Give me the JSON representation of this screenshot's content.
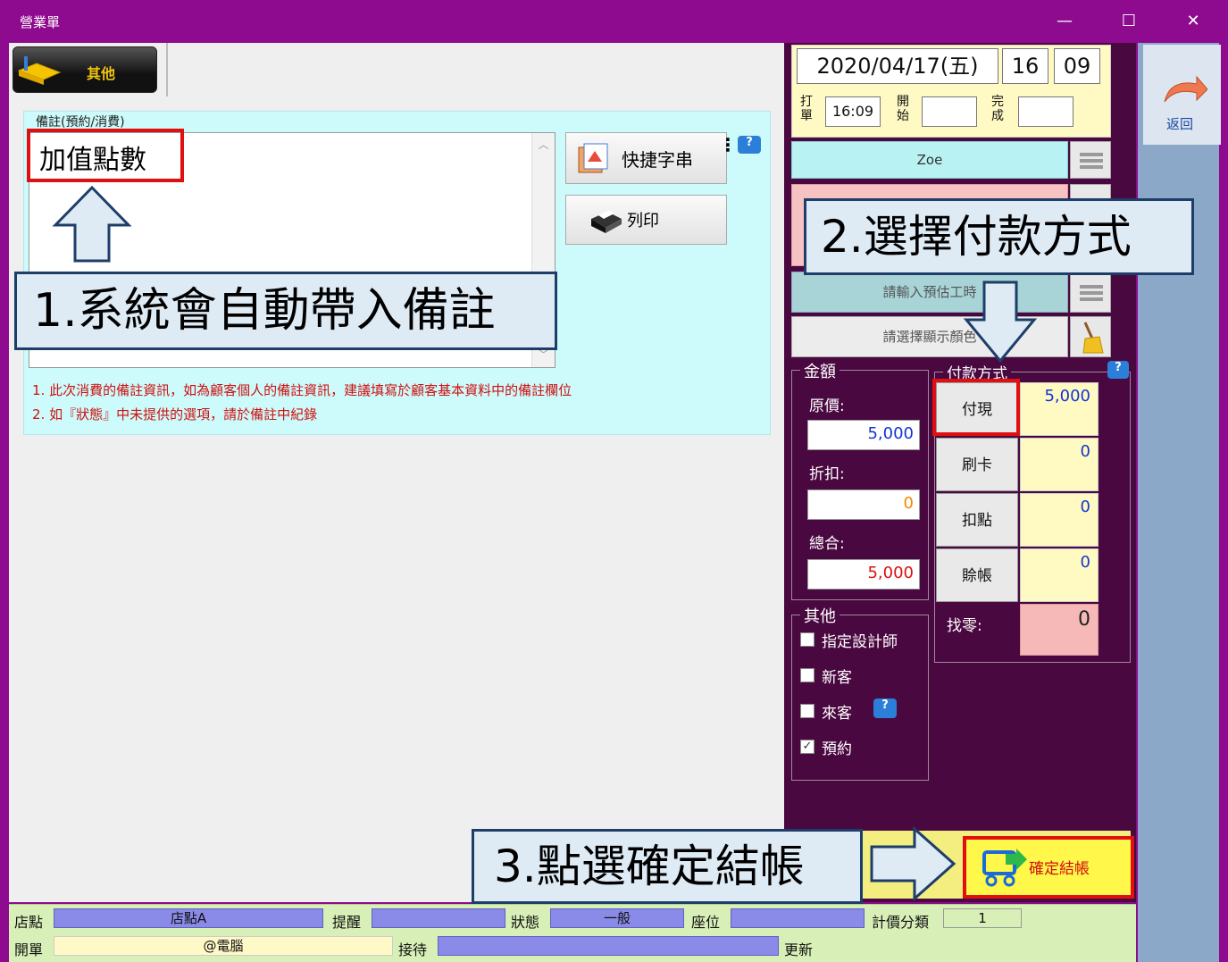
{
  "window": {
    "title": "營業單",
    "minimize": "—",
    "maximize": "☐",
    "close": "✕"
  },
  "tab": {
    "label": "其他"
  },
  "note": {
    "group_label": "備註(預約/消費)",
    "text": "加值點數",
    "quick_phrase": "快捷字串",
    "print": "列印",
    "hints": [
      "1. 此次消費的備註資訊，如為顧客個人的備註資訊，建議填寫於顧客基本資料中的備註欄位",
      "2. 如『狀態』中未提供的選項，請於備註中紀錄"
    ]
  },
  "datetime": {
    "date": "2020/04/17(五)",
    "hour": "16",
    "minute": "09",
    "punch_label": "打單",
    "punch_time": "16:09",
    "start_label": "開始",
    "start_time": "",
    "finish_label": "完成",
    "finish_time": ""
  },
  "staff": {
    "designer": "Zoe",
    "estimate_placeholder": "請輸入預估工時",
    "color_placeholder": "請選擇顯示顏色"
  },
  "amount": {
    "group_label": "金額",
    "original_label": "原價:",
    "original_value": "5,000",
    "discount_label": "折扣:",
    "discount_value": "0",
    "total_label": "總合:",
    "total_value": "5,000"
  },
  "payment": {
    "group_label": "付款方式",
    "methods": [
      {
        "label": "付現",
        "value": "5,000"
      },
      {
        "label": "刷卡",
        "value": "0"
      },
      {
        "label": "扣點",
        "value": "0"
      },
      {
        "label": "賒帳",
        "value": "0"
      }
    ],
    "change_label": "找零:",
    "change_value": "0"
  },
  "other": {
    "group_label": "其他",
    "options": [
      {
        "label": "指定設計師",
        "checked": false
      },
      {
        "label": "新客",
        "checked": false
      },
      {
        "label": "來客",
        "checked": false
      },
      {
        "label": "預約",
        "checked": true
      }
    ]
  },
  "actions": {
    "confirm": "確定結帳",
    "back": "返回"
  },
  "status": {
    "store_label": "店點",
    "store_value": "店點A",
    "reminder_label": "提醒",
    "reminder_value": "",
    "state_label": "狀態",
    "state_value": "一般",
    "seat_label": "座位",
    "seat_value": "",
    "price_class_label": "計價分類",
    "price_class_value": "1",
    "opener_label": "開單",
    "opener_value": "@電腦",
    "reception_label": "接待",
    "reception_value": "",
    "update_label": "更新"
  },
  "callouts": {
    "step1": "1.系統會自動帶入備註",
    "step2": "2.選擇付款方式",
    "step3": "3.點選確定結帳"
  },
  "colors": {
    "titlebar": "#8e0a8e",
    "dark_panel": "#4a0840",
    "highlight": "#e01010",
    "callout_bg": "#deeaf4"
  }
}
